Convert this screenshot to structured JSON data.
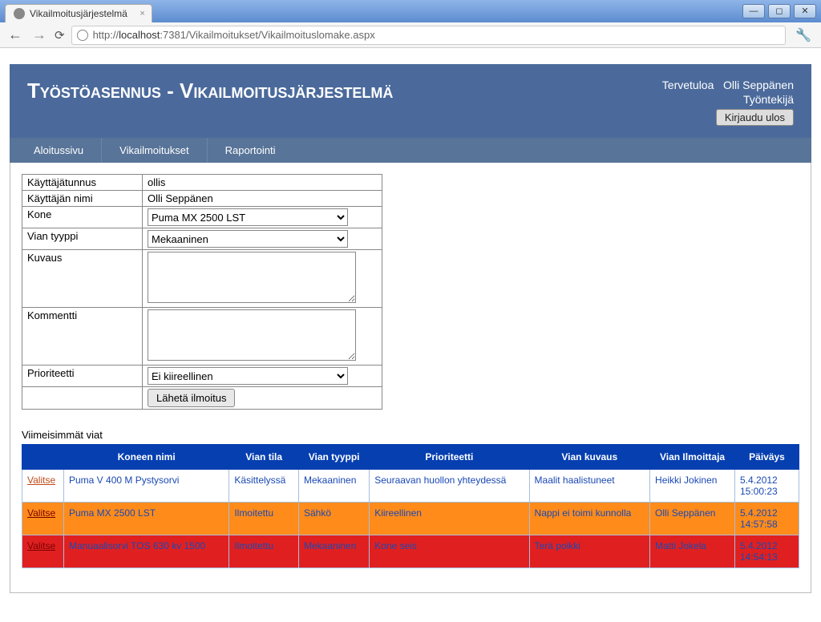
{
  "window": {
    "tab_title": "Vikailmoitusjärjestelmä",
    "url_prefix": "http://",
    "url_host": "localhost",
    "url_path": ":7381/Vikailmoitukset/Vikailmoituslomake.aspx"
  },
  "header": {
    "title": "Työstöasennus - Vikailmoitusjärjestelmä",
    "welcome": "Tervetuloa",
    "user_name": "Olli Seppänen",
    "role": "Työntekijä",
    "logout": "Kirjaudu ulos"
  },
  "nav": {
    "items": [
      "Aloitussivu",
      "Vikailmoitukset",
      "Raportointi"
    ]
  },
  "form": {
    "labels": {
      "username": "Käyttäjätunnus",
      "displayname": "Käyttäjän nimi",
      "machine": "Kone",
      "fault_type": "Vian tyyppi",
      "description": "Kuvaus",
      "comment": "Kommentti",
      "priority": "Prioriteetti"
    },
    "values": {
      "username": "ollis",
      "displayname": "Olli Seppänen",
      "machine": "Puma MX 2500 LST",
      "fault_type": "Mekaaninen",
      "description": "",
      "comment": "",
      "priority": "Ei kiireellinen"
    },
    "submit": "Lähetä ilmoitus"
  },
  "recent": {
    "heading": "Viimeisimmät viat",
    "select_label": "Valitse",
    "cols": {
      "machine": "Koneen nimi",
      "status": "Vian tila",
      "type": "Vian tyyppi",
      "priority": "Prioriteetti",
      "desc": "Vian kuvaus",
      "reporter": "Vian Ilmoittaja",
      "date": "Päiväys"
    },
    "rows": [
      {
        "css": "row-white",
        "machine": "Puma V 400 M Pystysorvi",
        "status": "Käsittelyssä",
        "type": "Mekaaninen",
        "priority": "Seuraavan huollon yhteydessä",
        "desc": "Maalit haalistuneet",
        "reporter": "Heikki Jokinen",
        "date": "5.4.2012 15:00:23"
      },
      {
        "css": "row-orange",
        "machine": "Puma MX 2500 LST",
        "status": "Ilmoitettu",
        "type": "Sähkö",
        "priority": "Kiireellinen",
        "desc": "Nappi ei toimi kunnolla",
        "reporter": "Olli Seppänen",
        "date": "5.4.2012 14:57:58"
      },
      {
        "css": "row-red",
        "machine": "Manuaalisorvi TOS 630 kv 1500",
        "status": "Ilmoitettu",
        "type": "Mekaaninen",
        "priority": "Kone seis",
        "desc": "Terä poikki",
        "reporter": "Matti Jokela",
        "date": "5.4.2012 14:54:13"
      }
    ]
  }
}
